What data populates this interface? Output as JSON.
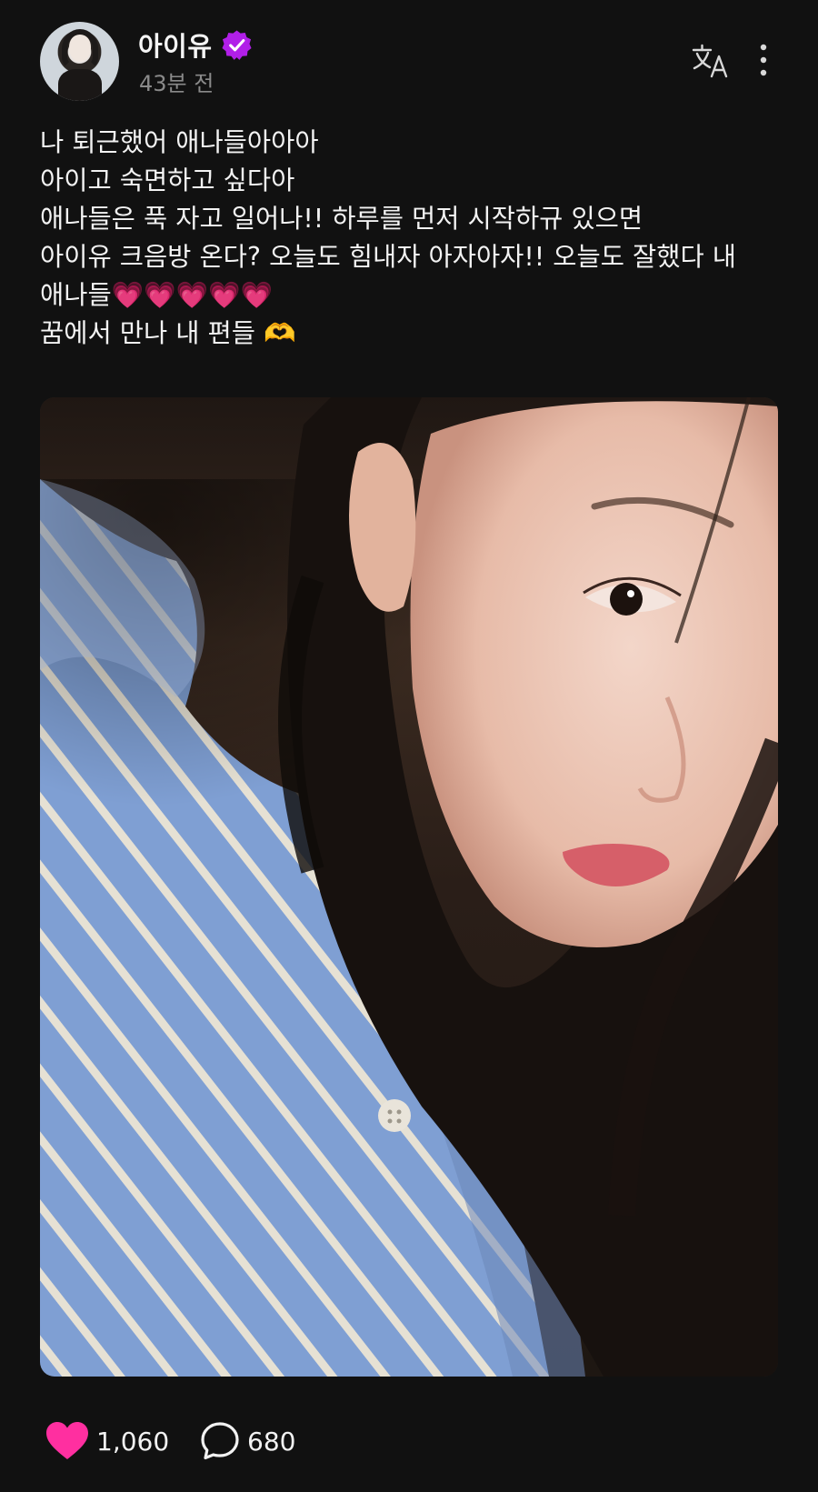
{
  "post": {
    "author": "아이유",
    "verified_icon": "verified-badge-icon",
    "time_ago": "43분 전",
    "lines": [
      "나 퇴근했어 애나들아아아",
      "아이고 숙면하고 싶다아",
      "애나들은 푹 자고 일어나!! 하루를 먼저 시작하규 있으면",
      "아이유 크음방 온다? 오늘도 힘내자 아자아자!! 오늘도 잘했다 내",
      "애나들",
      "꿈에서 만나 내 편들"
    ],
    "line5_emoji": "💗💗💗💗💗",
    "line6_emoji": "🫶",
    "image_alt": "selfie photo"
  },
  "header_actions": {
    "translate_icon": "translate-icon",
    "more_icon": "more-vertical-icon"
  },
  "actions": {
    "like_count": "1,060",
    "comment_count": "680"
  },
  "colors": {
    "background": "#111111",
    "accent_like": "#ff2fa0",
    "verified": "#b11fe8",
    "muted": "#8a8a8a"
  }
}
